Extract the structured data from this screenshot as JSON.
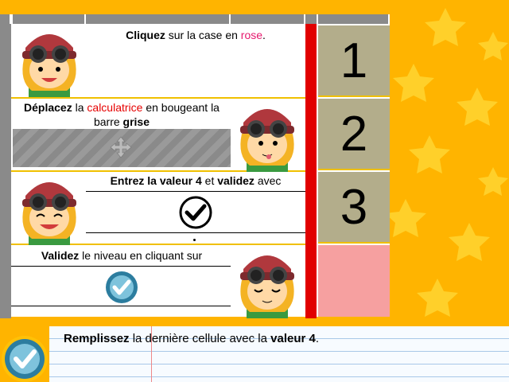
{
  "steps": [
    {
      "number": "1",
      "instruction": {
        "before": "Cliquez",
        "middle": " sur la case en ",
        "highlight": "rose",
        "after": "."
      }
    },
    {
      "number": "2",
      "instruction": {
        "before": "Déplacez",
        "middle": " la ",
        "highlight": "calculatrice",
        "after": " en bougeant la barre ",
        "bold_end": "grise"
      }
    },
    {
      "number": "3",
      "instruction": {
        "before": "Entrez la valeur 4",
        "middle": " et ",
        "bold2": "validez",
        "after": " avec"
      }
    },
    {
      "number": "",
      "instruction": {
        "before": "Validez",
        "middle": " le niveau en cliquant sur"
      }
    }
  ],
  "footer": {
    "bold1": "Remplissez",
    "text1": " la dernière cellule avec la ",
    "bold2": "valeur 4",
    "text2": "."
  },
  "colors": {
    "background": "#ffb400",
    "pink_cell": "#f6a0a0",
    "red_strip": "#e10000",
    "number_cell": "#b3ad8b",
    "validate_button": "#2c7d9f"
  },
  "icons": [
    "character-avatar",
    "move-icon",
    "checkmark-icon",
    "validate-check-icon"
  ]
}
